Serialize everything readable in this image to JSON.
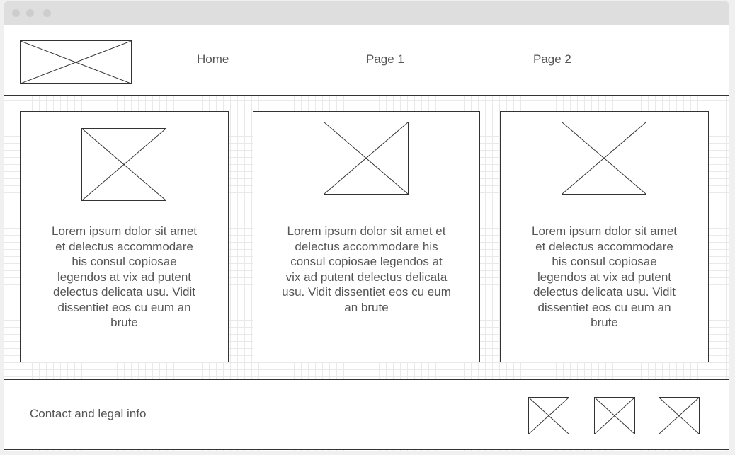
{
  "nav": {
    "logo_icon": "image-placeholder-icon",
    "links": [
      "Home",
      "Page 1",
      "Page 2"
    ]
  },
  "cards": [
    {
      "image_icon": "image-placeholder-icon",
      "text": "Lorem ipsum dolor sit amet et delectus accommodare his consul copiosae legendos at vix ad putent delectus delicata usu. Vidit dissentiet eos cu eum an brute"
    },
    {
      "image_icon": "image-placeholder-icon",
      "text": "Lorem ipsum dolor sit amet et delectus accommodare his consul copiosae legendos at vix ad putent delectus delicata usu. Vidit dissentiet eos cu eum an brute"
    },
    {
      "image_icon": "image-placeholder-icon",
      "text": "Lorem ipsum dolor sit amet et delectus accommodare his consul copiosae legendos at vix ad putent delectus delicata usu. Vidit dissentiet eos cu eum an brute"
    }
  ],
  "footer": {
    "text": "Contact and legal info",
    "icons": [
      "image-placeholder-icon",
      "image-placeholder-icon",
      "image-placeholder-icon"
    ]
  },
  "colors": {
    "border": "#333333",
    "text": "#555555",
    "titlebar": "#dedede",
    "grid": "#e9e9e9"
  }
}
